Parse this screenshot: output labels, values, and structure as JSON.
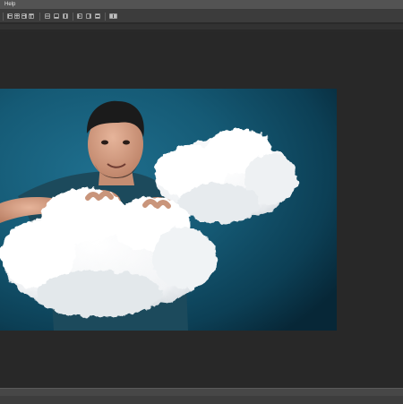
{
  "menubar": {
    "items": [
      {
        "label": "Help"
      }
    ]
  },
  "options_bar": {
    "buttons": [
      "align-left-edges-icon",
      "align-horizontal-centers-icon",
      "align-right-edges-icon",
      "align-top-edges-icon",
      "align-vertical-centers-icon",
      "align-bottom-edges-icon",
      "distribute-left-icon",
      "distribute-horizontal-icon",
      "distribute-right-icon",
      "distribute-top-icon",
      "auto-align-icon"
    ]
  },
  "colors": {
    "workspace": "#282828",
    "menubar": "#535353",
    "options_bar": "#3c3c3c",
    "backdrop_teal": "#145a76",
    "shirt": "#1c4a5c",
    "skin": "#d9a184",
    "hair": "#1b1b1b",
    "cloud": "#ffffff"
  }
}
